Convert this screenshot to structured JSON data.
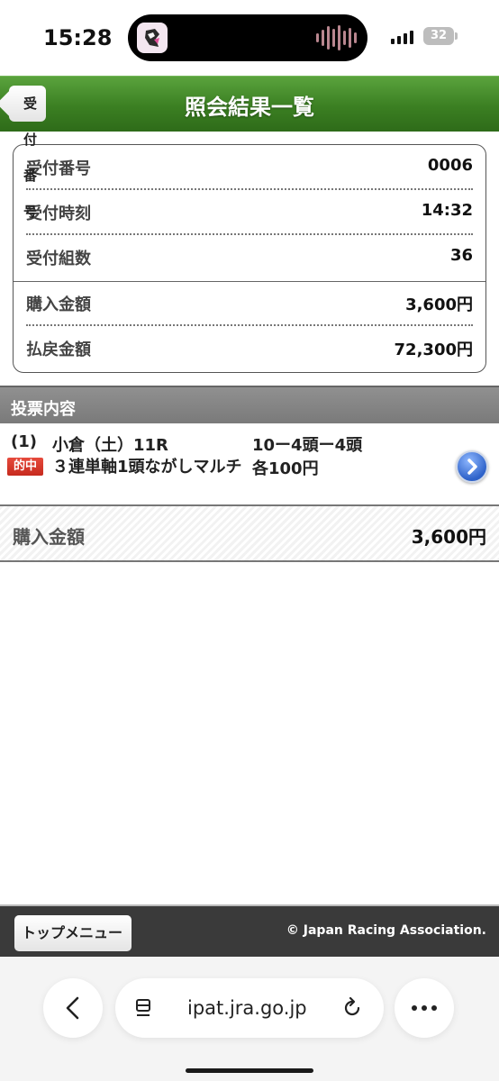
{
  "status_bar": {
    "time": "15:28",
    "battery": "32",
    "island_app_icon": "umajo-app-icon",
    "audio_icon": "audio-waveform-icon"
  },
  "header": {
    "back_label": "受付番号",
    "title": "照会結果一覧"
  },
  "summary": {
    "rows": [
      {
        "label": "受付番号",
        "value": "0006"
      },
      {
        "label": "受付時刻",
        "value": "14:32"
      },
      {
        "label": "受付組数",
        "value": "36"
      },
      {
        "label": "購入金額",
        "value": "3,600円"
      },
      {
        "label": "払戻金額",
        "value": "72,300円"
      }
    ]
  },
  "section": {
    "title": "投票内容"
  },
  "bets": [
    {
      "number": "(1)",
      "badge": "的中",
      "race": "小倉（土）11R",
      "type": "３連単軸1頭ながしマルチ",
      "combination": "10ー4頭ー4頭",
      "amount_each": "各100円"
    }
  ],
  "total": {
    "label": "購入金額",
    "value": "3,600円"
  },
  "footer": {
    "top_menu_label": "トップメニュー",
    "copyright": "© Japan Racing Association."
  },
  "browser": {
    "url": "ipat.jra.go.jp"
  },
  "colors": {
    "header_green": "#3b7f22",
    "section_gray": "#808080",
    "hit_red": "#d8352a",
    "arrow_blue": "#2e62c9",
    "footer_dark": "#3a3a3a"
  }
}
